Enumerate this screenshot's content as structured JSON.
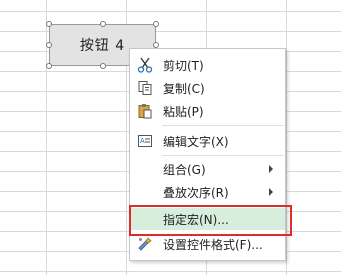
{
  "form_button": {
    "label": "按钮 4"
  },
  "context_menu": {
    "items": [
      {
        "label": "剪切(T)",
        "icon": "scissors-icon"
      },
      {
        "label": "复制(C)",
        "icon": "copy-icon"
      },
      {
        "label": "粘贴(P)",
        "icon": "paste-icon"
      },
      {
        "label": "编辑文字(X)",
        "icon": "edit-text-icon"
      },
      {
        "label": "组合(G)",
        "has_submenu": true
      },
      {
        "label": "叠放次序(R)",
        "has_submenu": true
      },
      {
        "label": "指定宏(N)...",
        "highlighted": true
      },
      {
        "label": "设置控件格式(F)...",
        "icon": "format-control-icon"
      }
    ]
  },
  "colors": {
    "highlight_fill": "#d7eedd",
    "annotation_border": "#e02b2b"
  }
}
